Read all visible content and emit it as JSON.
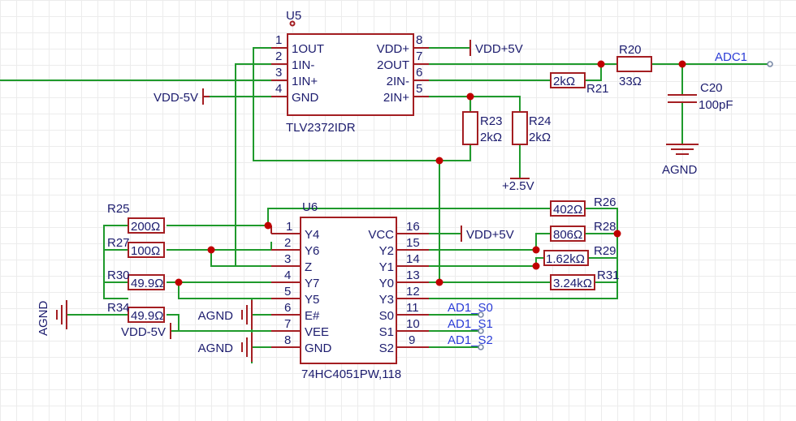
{
  "u5": {
    "ref": "U5",
    "part": "TLV2372IDR",
    "pins_left": [
      {
        "num": "1",
        "name": "1OUT"
      },
      {
        "num": "2",
        "name": "1IN-"
      },
      {
        "num": "3",
        "name": "1IN+"
      },
      {
        "num": "4",
        "name": "GND"
      }
    ],
    "pins_right": [
      {
        "num": "8",
        "name": "VDD+"
      },
      {
        "num": "7",
        "name": "2OUT"
      },
      {
        "num": "6",
        "name": "2IN-"
      },
      {
        "num": "5",
        "name": "2IN+"
      }
    ]
  },
  "u6": {
    "ref": "U6",
    "part": "74HC4051PW,118",
    "pins_left": [
      {
        "num": "1",
        "name": "Y4"
      },
      {
        "num": "2",
        "name": "Y6"
      },
      {
        "num": "3",
        "name": "Z"
      },
      {
        "num": "4",
        "name": "Y7"
      },
      {
        "num": "5",
        "name": "Y5"
      },
      {
        "num": "6",
        "name": "E#"
      },
      {
        "num": "7",
        "name": "VEE"
      },
      {
        "num": "8",
        "name": "GND"
      }
    ],
    "pins_right": [
      {
        "num": "16",
        "name": "VCC"
      },
      {
        "num": "15",
        "name": "Y2"
      },
      {
        "num": "14",
        "name": "Y1"
      },
      {
        "num": "13",
        "name": "Y0"
      },
      {
        "num": "12",
        "name": "Y3"
      },
      {
        "num": "11",
        "name": "S0"
      },
      {
        "num": "10",
        "name": "S1"
      },
      {
        "num": "9",
        "name": "S2"
      }
    ]
  },
  "resistors": {
    "r20": {
      "ref": "R20",
      "value": "33Ω"
    },
    "r21": {
      "ref": "R21",
      "value": "2kΩ"
    },
    "r23": {
      "ref": "R23",
      "value": "2kΩ"
    },
    "r24": {
      "ref": "R24",
      "value": "2kΩ"
    },
    "r25": {
      "ref": "R25",
      "value": "200Ω"
    },
    "r26": {
      "ref": "R26",
      "value": "402Ω"
    },
    "r27": {
      "ref": "R27",
      "value": "100Ω"
    },
    "r28": {
      "ref": "R28",
      "value": "806Ω"
    },
    "r29": {
      "ref": "R29",
      "value": "1.62kΩ"
    },
    "r30": {
      "ref": "R30",
      "value": "49.9Ω"
    },
    "r31": {
      "ref": "R31",
      "value": "3.24kΩ"
    },
    "r34": {
      "ref": "R34",
      "value": "49.9Ω"
    }
  },
  "capacitor": {
    "ref": "C20",
    "value": "100pF"
  },
  "power": {
    "vdd_pos_u5": "VDD+5V",
    "vdd_neg_u5": "VDD-5V",
    "vdd_pos_u6": "VDD+5V",
    "vdd_neg_u6": "VDD-5V",
    "ref_2v5": "+2.5V",
    "agnd_c20": "AGND",
    "agnd_left": "AGND",
    "agnd_e": "AGND",
    "agnd_gnd": "AGND"
  },
  "nets": {
    "adc": "ADC1",
    "s0": "AD1_S0",
    "s1": "AD1_S1",
    "s2": "AD1_S2"
  },
  "colors": {
    "wire": "#1f9a2c",
    "component": "#a41e22",
    "junction": "#c00000",
    "label_text": "#1c1c6e",
    "net_label": "#2b3cd6"
  }
}
